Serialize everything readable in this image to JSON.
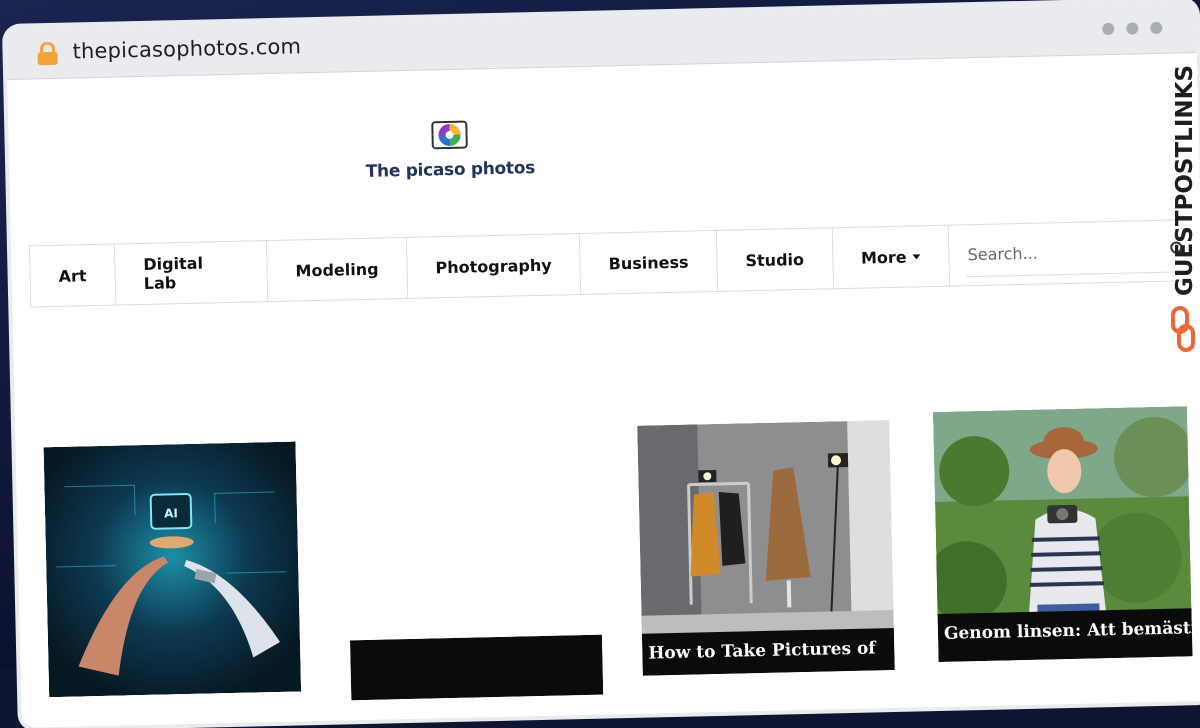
{
  "browser": {
    "url": "thepicasophotos.com"
  },
  "site": {
    "logo_text": "The picaso photos"
  },
  "nav": {
    "items": [
      "Art",
      "Digital Lab",
      "Modeling",
      "Photography",
      "Business",
      "Studio"
    ],
    "more_label": "More",
    "search_placeholder": "Search..."
  },
  "cards": [
    {
      "image": "ai-robot-hand",
      "caption": ""
    },
    {
      "image": "blank",
      "caption": ""
    },
    {
      "image": "clothing-studio",
      "caption": "How to Take Pictures of"
    },
    {
      "image": "woman-with-camera",
      "caption": "Genom linsen: Att bemästra"
    }
  ],
  "watermark": {
    "text": "GUESTPOSTLINKS"
  },
  "colors": {
    "nav_text": "#111111",
    "logo_text": "#22335e",
    "watermark": "#1e1e24",
    "watermark_icon": "#f0663a",
    "lock": "#f2a33a"
  }
}
